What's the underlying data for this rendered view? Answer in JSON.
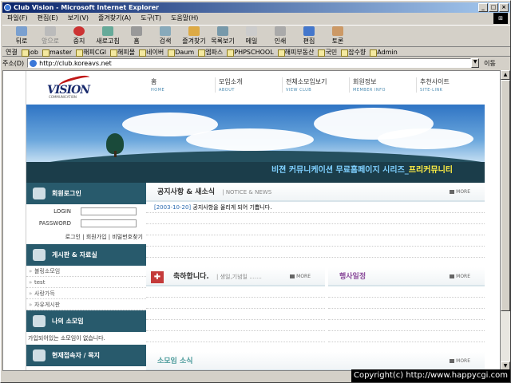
{
  "window": {
    "title": "Club Vision - Microsoft Internet Explorer",
    "btn_min": "_",
    "btn_max": "□",
    "btn_close": "×"
  },
  "menu": [
    "파일(F)",
    "편집(E)",
    "보기(V)",
    "즐겨찾기(A)",
    "도구(T)",
    "도움말(H)"
  ],
  "toolbar": {
    "back": "뒤로",
    "forward": "앞으로",
    "stop": "중지",
    "refresh": "새로고침",
    "home": "홈",
    "search": "검색",
    "favorites": "즐겨찾기",
    "history": "목록보기",
    "mail": "메일",
    "print": "인쇄",
    "edit": "편집",
    "discuss": "토론"
  },
  "links": {
    "label": "연결",
    "items": [
      "job",
      "master",
      "해피CGI",
      "해피몰",
      "네이버",
      "Daum",
      "엠파스",
      "PHPSCHOOL",
      "해피부동산",
      "국민",
      "잡수향",
      "Admin"
    ]
  },
  "address": {
    "label": "주소(D)",
    "url": "http://club.koreavs.net",
    "go": "이동"
  },
  "site": {
    "logo_text": "VISION",
    "logo_sub": "COMMUNICATION",
    "nav": [
      {
        "ko": "홈",
        "en": "HOME"
      },
      {
        "ko": "모임소개",
        "en": "ABOUT"
      },
      {
        "ko": "전체소모임보기",
        "en": "VIEW CLUB"
      },
      {
        "ko": "회원정보",
        "en": "MEMBER INFO"
      },
      {
        "ko": "추천사이트",
        "en": "SITE-LINK"
      }
    ],
    "banner_text": "비젼 커뮤니케이션 무료홈페이지 시리즈_",
    "banner_highlight": "프리커뮤니티"
  },
  "login": {
    "title": "회원로그인",
    "login_label": "LOGIN",
    "password_label": "PASSWORD",
    "links": "로그인 | 회원가입 | 비밀번호찾기"
  },
  "board": {
    "title": "게시판 & 자료실",
    "items": [
      "볼링소모임",
      "test",
      "사랑가득",
      "자유게시판"
    ]
  },
  "myclub": {
    "title": "나의 소모임",
    "empty": "가입되어있는 소모임이 없습니다."
  },
  "visitors": {
    "title": "현재접속자 / 목지"
  },
  "notice": {
    "title": "공지사항 & 새소식",
    "sub": "NOTICE & NEWS",
    "more": "MORE",
    "rows": [
      {
        "date": "[2003-10-20]",
        "text": "공지사항을 올리게 되어 기쁩니다."
      }
    ]
  },
  "congrats": {
    "title": "축하합니다.",
    "sub": "생일,기념일 .......",
    "more": "MORE"
  },
  "events": {
    "title": "행사일정",
    "more": "MORE"
  },
  "clubnews": {
    "title": "소모임 소식",
    "more": "MORE"
  },
  "copyright": "Copyright(c) http://www.happycgi.com"
}
